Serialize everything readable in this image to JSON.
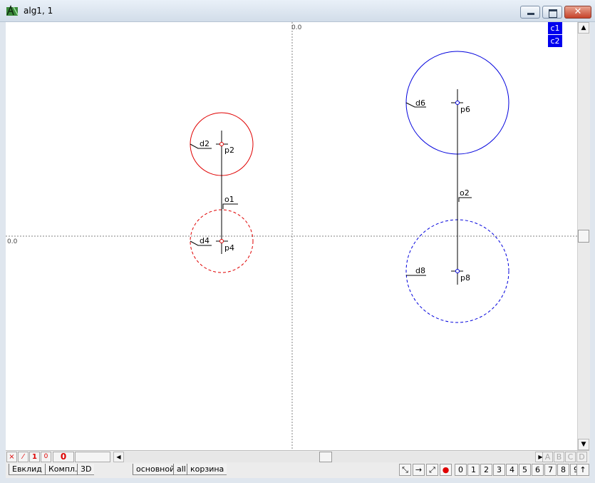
{
  "window": {
    "title": "alg1, 1",
    "close_label": "✕"
  },
  "canvas": {
    "origin_label_top": "0.0",
    "origin_label_left": "0.0",
    "colors": {
      "red": "#e00000",
      "blue": "#0000dd",
      "black": "#000000",
      "axis": "#808080"
    },
    "labels": {
      "d2": "d2",
      "p2": "p2",
      "o1": "o1",
      "d4": "d4",
      "p4": "p4",
      "d6": "d6",
      "p6": "p6",
      "o2": "o2",
      "d8": "d8",
      "p8": "p8"
    }
  },
  "legend": [
    "c1",
    "c2"
  ],
  "status": {
    "x_label": "×",
    "slash_label": "⁄",
    "one_label": "1",
    "zero_small_label": "0",
    "zero_big_label": "0"
  },
  "letters": [
    "A",
    "B",
    "C",
    "D"
  ],
  "tabs_left": [
    "Евклид",
    "Компл.",
    "3D"
  ],
  "tabs_right": [
    "основной",
    "all",
    "корзина"
  ],
  "tools": [
    "0",
    "1",
    "2",
    "3",
    "4",
    "5",
    "6",
    "7",
    "8",
    "9",
    "↑"
  ]
}
